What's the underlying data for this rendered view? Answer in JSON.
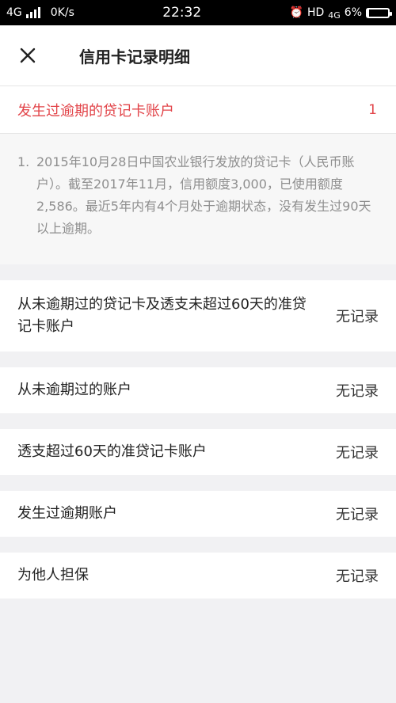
{
  "status_bar": {
    "network": "4G",
    "speed": "0K/s",
    "time": "22:32",
    "hd": "HD",
    "network2": "4G",
    "battery": "6%",
    "battery_level": 0.06
  },
  "header": {
    "title": "信用卡记录明细",
    "close_icon": "close-icon"
  },
  "overdue_section": {
    "title": "发生过逾期的贷记卡账户",
    "count": "1",
    "items": [
      {
        "index": "1.",
        "text": "2015年10月28日中国农业银行发放的贷记卡（人民币账户）。截至2017年11月，信用额度3,000，已使用额度2,586。最近5年内有4个月处于逾期状态，没有发生过90天以上逾期。"
      }
    ]
  },
  "records": [
    {
      "label": "从未逾期过的贷记卡及透支未超过60天的准贷记卡账户",
      "status": "无记录"
    },
    {
      "label": "从未逾期过的账户",
      "status": "无记录"
    },
    {
      "label": "透支超过60天的准贷记卡账户",
      "status": "无记录"
    },
    {
      "label": "发生过逾期账户",
      "status": "无记录"
    },
    {
      "label": "为他人担保",
      "status": "无记录"
    }
  ]
}
